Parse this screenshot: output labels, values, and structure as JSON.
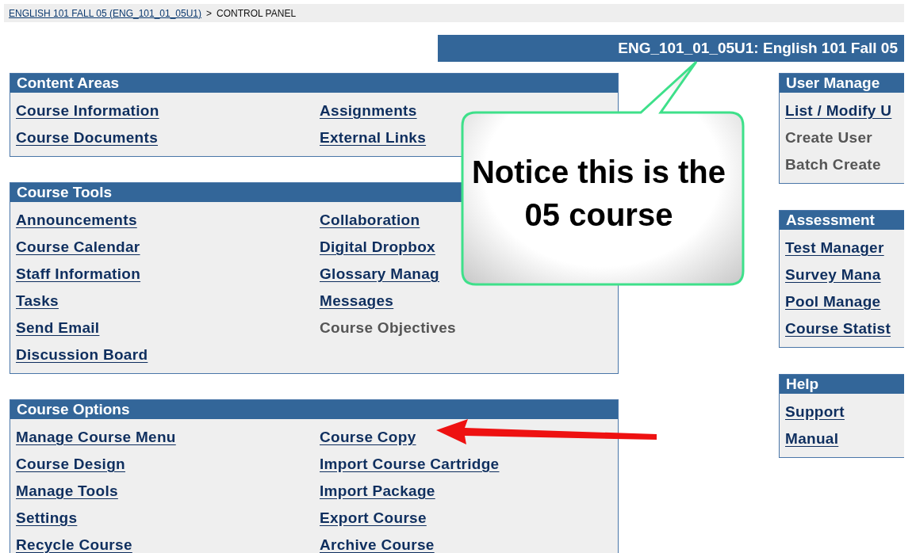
{
  "breadcrumb": {
    "link": "ENGLISH 101 FALL 05 (ENG_101_01_05U1)",
    "separator": ">",
    "current": "CONTROL PANEL"
  },
  "course_title": "ENG_101_01_05U1: English 101 Fall 05",
  "left_panels": [
    {
      "title": "Content Areas",
      "items": [
        {
          "label": "Course Information",
          "disabled": false
        },
        {
          "label": "Assignments",
          "disabled": false
        },
        {
          "label": "Course Documents",
          "disabled": false
        },
        {
          "label": "External Links",
          "disabled": false
        }
      ]
    },
    {
      "title": "Course Tools",
      "items": [
        {
          "label": "Announcements",
          "disabled": false
        },
        {
          "label": "Collaboration",
          "disabled": false
        },
        {
          "label": "Course Calendar",
          "disabled": false
        },
        {
          "label": "Digital Dropbox",
          "disabled": false
        },
        {
          "label": "Staff Information",
          "disabled": false
        },
        {
          "label": "Glossary Manag",
          "disabled": false
        },
        {
          "label": "Tasks",
          "disabled": false
        },
        {
          "label": "Messages",
          "disabled": false
        },
        {
          "label": "Send Email",
          "disabled": false
        },
        {
          "label": "Course Objectives",
          "disabled": true
        },
        {
          "label": "Discussion Board",
          "disabled": false
        }
      ]
    },
    {
      "title": "Course Options",
      "items": [
        {
          "label": "Manage Course Menu",
          "disabled": false
        },
        {
          "label": "Course Copy",
          "disabled": false
        },
        {
          "label": "Course Design",
          "disabled": false
        },
        {
          "label": "Import Course Cartridge",
          "disabled": false
        },
        {
          "label": "Manage Tools",
          "disabled": false
        },
        {
          "label": "Import Package",
          "disabled": false
        },
        {
          "label": "Settings",
          "disabled": false
        },
        {
          "label": "Export Course",
          "disabled": false
        },
        {
          "label": "Recycle Course",
          "disabled": false
        },
        {
          "label": "Archive Course",
          "disabled": false
        }
      ]
    }
  ],
  "right_panels": [
    {
      "title": "User Manage",
      "items": [
        {
          "label": "List / Modify U",
          "disabled": false
        },
        {
          "label": "Create User",
          "disabled": true
        },
        {
          "label": "Batch Create",
          "disabled": true
        }
      ]
    },
    {
      "title": "Assessment",
      "items": [
        {
          "label": "Test Manager",
          "disabled": false
        },
        {
          "label": "Survey Mana",
          "disabled": false
        },
        {
          "label": "Pool Manage",
          "disabled": false
        },
        {
          "label": "Course Statist",
          "disabled": false
        }
      ]
    },
    {
      "title": "Help",
      "items": [
        {
          "label": "Support",
          "disabled": false
        },
        {
          "label": "Manual",
          "disabled": false
        }
      ]
    }
  ],
  "callout": {
    "text": "Notice this is the 05 course"
  }
}
